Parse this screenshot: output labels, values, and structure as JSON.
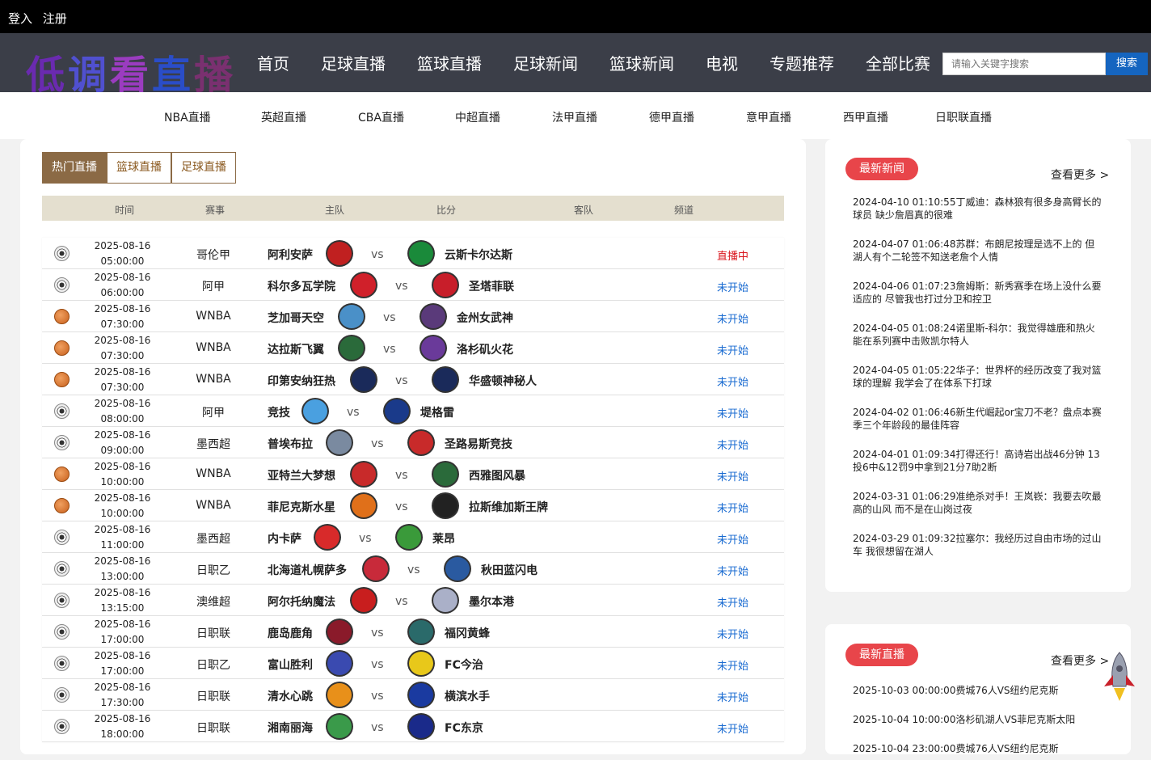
{
  "topbar": {
    "login": "登入",
    "register": "注册"
  },
  "logo": {
    "chars": [
      "低",
      "调",
      "看",
      "直",
      "播"
    ]
  },
  "nav": [
    "首页",
    "足球直播",
    "篮球直播",
    "足球新闻",
    "篮球新闻",
    "电视",
    "专题推荐",
    "全部比赛"
  ],
  "search": {
    "placeholder": "请输入关键字搜索",
    "button": "搜索"
  },
  "subnav": [
    "NBA直播",
    "英超直播",
    "CBA直播",
    "中超直播",
    "法甲直播",
    "德甲直播",
    "意甲直播",
    "西甲直播",
    "日职联直播"
  ],
  "tabs": [
    "热门直播",
    "篮球直播",
    "足球直播"
  ],
  "table_headers": [
    "时间",
    "赛事",
    "主队",
    "比分",
    "客队",
    "频道"
  ],
  "matches": [
    {
      "sport": "soccer",
      "date": "2025-08-16",
      "time": "05:00:00",
      "league": "哥伦甲",
      "home": "阿利安萨",
      "away": "云斯卡尔达斯",
      "status": "直播中",
      "live": true,
      "hc": "#c02020",
      "ac": "#1a8a3a"
    },
    {
      "sport": "soccer",
      "date": "2025-08-16",
      "time": "06:00:00",
      "league": "阿甲",
      "home": "科尔多瓦学院",
      "away": "圣塔菲联",
      "status": "未开始",
      "live": false,
      "hc": "#d0202a",
      "ac": "#c81e2a"
    },
    {
      "sport": "basket",
      "date": "2025-08-16",
      "time": "07:30:00",
      "league": "WNBA",
      "home": "芝加哥天空",
      "away": "金州女武神",
      "status": "未开始",
      "live": false,
      "hc": "#4a90c8",
      "ac": "#5a3a7a"
    },
    {
      "sport": "basket",
      "date": "2025-08-16",
      "time": "07:30:00",
      "league": "WNBA",
      "home": "达拉斯飞翼",
      "away": "洛杉矶火花",
      "status": "未开始",
      "live": false,
      "hc": "#2a6a3a",
      "ac": "#6a3a9a"
    },
    {
      "sport": "basket",
      "date": "2025-08-16",
      "time": "07:30:00",
      "league": "WNBA",
      "home": "印第安纳狂热",
      "away": "华盛顿神秘人",
      "status": "未开始",
      "live": false,
      "hc": "#1a2a5a",
      "ac": "#1a2a5a"
    },
    {
      "sport": "soccer",
      "date": "2025-08-16",
      "time": "08:00:00",
      "league": "阿甲",
      "home": "竞技",
      "away": "堤格雷",
      "status": "未开始",
      "live": false,
      "hc": "#4aa0e0",
      "ac": "#1a3a8a"
    },
    {
      "sport": "soccer",
      "date": "2025-08-16",
      "time": "09:00:00",
      "league": "墨西超",
      "home": "普埃布拉",
      "away": "圣路易斯竞技",
      "status": "未开始",
      "live": false,
      "hc": "#7a8aa0",
      "ac": "#c82a2a"
    },
    {
      "sport": "basket",
      "date": "2025-08-16",
      "time": "10:00:00",
      "league": "WNBA",
      "home": "亚特兰大梦想",
      "away": "西雅图风暴",
      "status": "未开始",
      "live": false,
      "hc": "#c82a2a",
      "ac": "#2a6a3a"
    },
    {
      "sport": "basket",
      "date": "2025-08-16",
      "time": "10:00:00",
      "league": "WNBA",
      "home": "菲尼克斯水星",
      "away": "拉斯维加斯王牌",
      "status": "未开始",
      "live": false,
      "hc": "#e0701a",
      "ac": "#222222"
    },
    {
      "sport": "soccer",
      "date": "2025-08-16",
      "time": "11:00:00",
      "league": "墨西超",
      "home": "内卡萨",
      "away": "莱昂",
      "status": "未开始",
      "live": false,
      "hc": "#d82a2a",
      "ac": "#3a9a3a"
    },
    {
      "sport": "soccer",
      "date": "2025-08-16",
      "time": "13:00:00",
      "league": "日职乙",
      "home": "北海道札幌萨多",
      "away": "秋田蓝闪电",
      "status": "未开始",
      "live": false,
      "hc": "#c82a3a",
      "ac": "#2a5aa0"
    },
    {
      "sport": "soccer",
      "date": "2025-08-16",
      "time": "13:15:00",
      "league": "澳维超",
      "home": "阿尔托纳魔法",
      "away": "墨尔本港",
      "status": "未开始",
      "live": false,
      "hc": "#c81e1e",
      "ac": "#aab0c8"
    },
    {
      "sport": "soccer",
      "date": "2025-08-16",
      "time": "17:00:00",
      "league": "日职联",
      "home": "鹿岛鹿角",
      "away": "福冈黄蜂",
      "status": "未开始",
      "live": false,
      "hc": "#8a1a2a",
      "ac": "#2a6a6a"
    },
    {
      "sport": "soccer",
      "date": "2025-08-16",
      "time": "17:00:00",
      "league": "日职乙",
      "home": "富山胜利",
      "away": "FC今治",
      "status": "未开始",
      "live": false,
      "hc": "#3a4ab0",
      "ac": "#e8c81a"
    },
    {
      "sport": "soccer",
      "date": "2025-08-16",
      "time": "17:30:00",
      "league": "日职联",
      "home": "清水心跳",
      "away": "横滨水手",
      "status": "未开始",
      "live": false,
      "hc": "#e8901a",
      "ac": "#1a3aa0"
    },
    {
      "sport": "soccer",
      "date": "2025-08-16",
      "time": "18:00:00",
      "league": "日职联",
      "home": "湘南丽海",
      "away": "FC东京",
      "status": "未开始",
      "live": false,
      "hc": "#3a9a4a",
      "ac": "#1a2a8a"
    }
  ],
  "news_panel": {
    "title": "最新新闻",
    "more": "查看更多 >"
  },
  "news": [
    "2024-04-10 01:10:55丁威迪：森林狼有很多身高臂长的球员 缺少詹眉真的很难",
    "2024-04-07 01:06:48苏群：布朗尼按理是选不上的 但湖人有个二轮签不知送老詹个人情",
    "2024-04-06 01:07:23詹姆斯：新秀赛季在场上没什么要适应的 尽管我也打过分卫和控卫",
    "2024-04-05 01:08:24诺里斯-科尔：我觉得雄鹿和热火能在系列赛中击败凯尔特人",
    "2024-04-05 01:05:22华子：世界杯的经历改变了我对篮球的理解 我学会了在体系下打球",
    "2024-04-02 01:06:46新生代崛起or宝刀不老？盘点本赛季三个年龄段的最佳阵容",
    "2024-04-01 01:09:34打得还行！高诗岩出战46分钟 13投6中&12罚9中拿到21分7助2断",
    "2024-03-31 01:06:29准绝杀对手！王岚嵚：我要去吹最高的山风 而不是在山岗过夜",
    "2024-03-29 01:09:32拉塞尔：我经历过自由市场的过山车 我很想留在湖人"
  ],
  "live_panel": {
    "title": "最新直播",
    "more": "查看更多 >"
  },
  "live_list": [
    "2025-10-03 00:00:00费城76人VS纽约尼克斯",
    "2025-10-04 10:00:00洛杉矶湖人VS菲尼克斯太阳",
    "2025-10-04 23:00:00费城76人VS纽约尼克斯"
  ]
}
